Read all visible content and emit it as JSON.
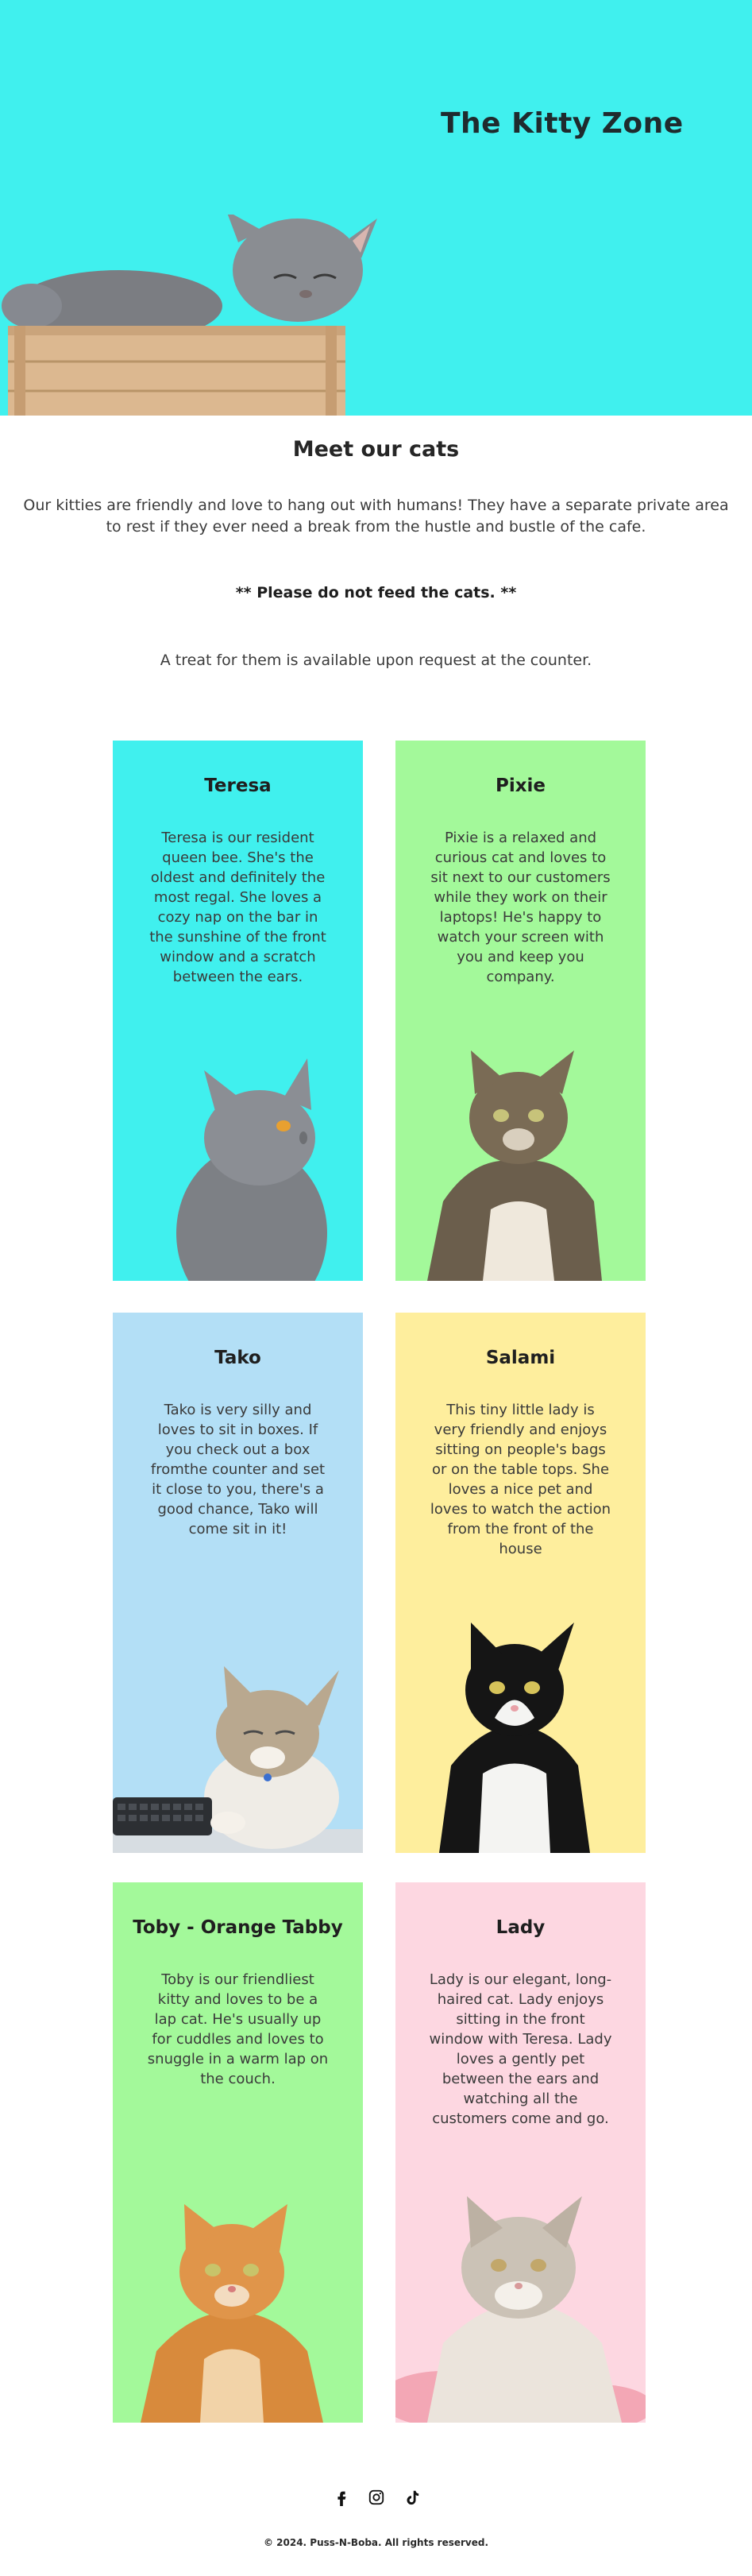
{
  "hero": {
    "title": "The Kitty Zone",
    "background": "#40F0EE"
  },
  "intro": {
    "heading": "Meet our cats",
    "body": "Our kitties are friendly and love to hang out with humans! They have a separate private area to rest if they ever need a break from the hustle and bustle of the cafe.",
    "warning": "** Please do not feed the cats. **",
    "treat": "A treat for them is available upon request at the counter."
  },
  "cats": [
    {
      "name": "Teresa",
      "description": "Teresa is our resident queen bee. She's the oldest and definitely the most regal. She loves a cozy nap on the bar in the sunshine of the front window and a scratch between the ears.",
      "color": "#40F0EE",
      "image": "grey-cat-looking-up"
    },
    {
      "name": "Pixie",
      "description": "Pixie is a relaxed and curious cat and loves to sit next to our customers while they work on their laptops! He's happy to watch your screen with you and keep you company.",
      "color": "#A3F99A",
      "image": "tabby-cat-sitting"
    },
    {
      "name": "Tako",
      "description": "Tako is very silly and loves to sit in boxes. If you check out a box fromthe counter and set it close to you, there's a good chance, Tako will come sit in it!",
      "color": "#B3DFF6",
      "image": "cat-next-to-keyboard"
    },
    {
      "name": "Salami",
      "description": "This tiny little lady is very friendly and enjoys sitting on people's bags or on the table tops. She loves a nice pet and loves to watch the action from the front of the house",
      "color": "#FEEE9D",
      "image": "tuxedo-cat"
    },
    {
      "name": "Toby - Orange Tabby",
      "description": "Toby is our friendliest kitty and loves to be a lap cat. He's usually up for cuddles and loves to snuggle in a warm lap on the couch.",
      "color": "#A3F99A",
      "image": "orange-tabby-cat"
    },
    {
      "name": "Lady",
      "description": "Lady is our elegant, long-haired cat. Lady enjoys sitting in the front window with Teresa. Lady loves a gently pet between the ears and watching all the customers come and go.",
      "color": "#FDD7E1",
      "image": "long-haired-cat"
    }
  ],
  "footer": {
    "social": [
      "facebook-icon",
      "instagram-icon",
      "tiktok-icon"
    ],
    "copyright": "© 2024. Puss-N-Boba. All rights reserved."
  }
}
